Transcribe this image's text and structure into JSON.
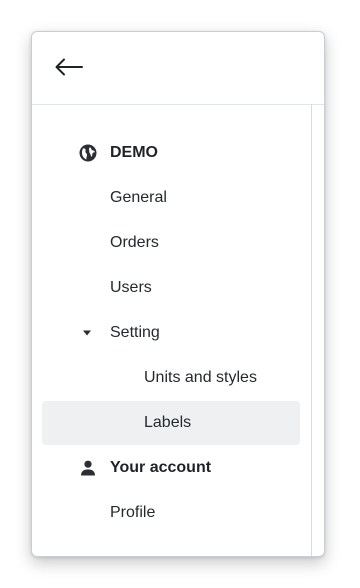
{
  "header": {
    "back_icon": "arrow-left-icon"
  },
  "nav": {
    "site": {
      "label": "DEMO",
      "icon": "globe-icon"
    },
    "general": {
      "label": "General"
    },
    "orders": {
      "label": "Orders"
    },
    "users": {
      "label": "Users"
    },
    "setting": {
      "label": "Setting",
      "icon": "caret-down-icon",
      "expanded": true
    },
    "units_and_styles": {
      "label": "Units and styles"
    },
    "labels": {
      "label": "Labels",
      "active": true
    },
    "account": {
      "label": "Your account",
      "icon": "user-icon"
    },
    "profile": {
      "label": "Profile"
    }
  },
  "colors": {
    "active_bg": "#eef0f2",
    "text": "#24292f",
    "border": "#c9ced6"
  }
}
